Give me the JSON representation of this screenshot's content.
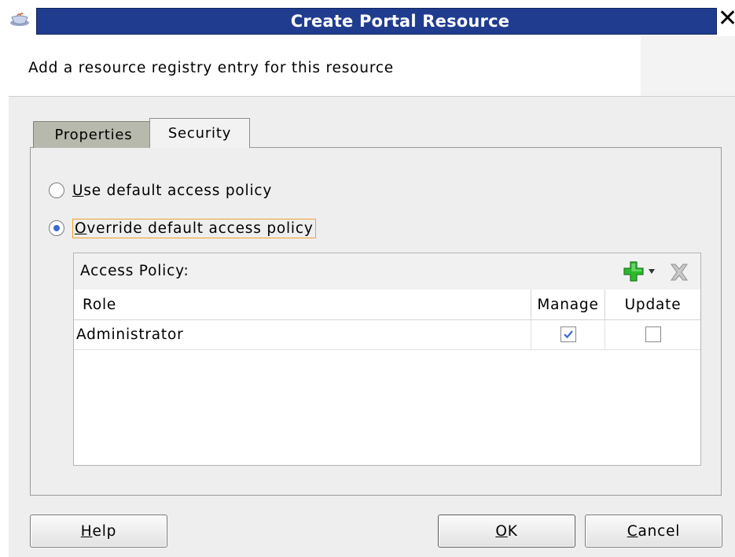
{
  "window": {
    "title": "Create Portal Resource",
    "title_bar_color": "#1f3c8f",
    "app_icon": "java-cup-icon",
    "close_icon": "close-icon"
  },
  "header": {
    "description": "Add a resource registry entry for this resource"
  },
  "tabs": [
    {
      "label": "Properties",
      "selected": false
    },
    {
      "label": "Security",
      "selected": true
    }
  ],
  "access_options": {
    "default": {
      "mnemonic": "U",
      "rest": "se default access policy",
      "selected": false
    },
    "override": {
      "mnemonic": "O",
      "rest": "verride default access policy",
      "selected": true
    }
  },
  "policy": {
    "title": "Access Policy:",
    "add_icon": "add-icon",
    "delete_icon": "delete-icon",
    "columns": {
      "role": "Role",
      "manage": "Manage",
      "update": "Update"
    },
    "rows": [
      {
        "role": "Administrator",
        "manage": true,
        "update": false
      }
    ]
  },
  "buttons": {
    "help": {
      "mnemonic": "H",
      "rest": "elp"
    },
    "ok": {
      "mnemonic": "O",
      "rest": "K"
    },
    "cancel": {
      "mnemonic": "C",
      "rest": "ancel"
    }
  },
  "colors": {
    "accent": "#3a6bc9",
    "focus": "#f0a030",
    "add_green": "#2db82d"
  }
}
